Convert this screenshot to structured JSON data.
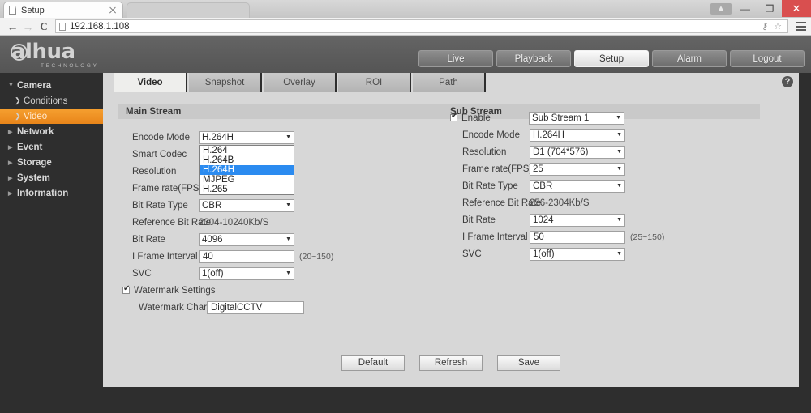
{
  "browser": {
    "tab_title": "Setup",
    "url": "192.168.1.108",
    "back_icon": "back-arrow-icon",
    "forward_icon": "forward-arrow-icon",
    "reload_icon": "reload-icon",
    "key_icon": "key-icon",
    "star_icon": "star-icon",
    "menu_icon": "hamburger-menu-icon",
    "minimize_label": "—",
    "restore_label": "❐",
    "close_label": "✕"
  },
  "brand": {
    "name": "alhua",
    "tagline": "TECHNOLOGY"
  },
  "topnav": {
    "items": [
      {
        "label": "Live",
        "active": false
      },
      {
        "label": "Playback",
        "active": false
      },
      {
        "label": "Setup",
        "active": true
      },
      {
        "label": "Alarm",
        "active": false
      },
      {
        "label": "Logout",
        "active": false
      }
    ]
  },
  "sidebar": {
    "items": [
      {
        "label": "Camera",
        "level": 0,
        "expanded": true,
        "active": false
      },
      {
        "label": "Conditions",
        "level": 1,
        "expanded": false,
        "active": false
      },
      {
        "label": "Video",
        "level": 1,
        "expanded": false,
        "active": true
      },
      {
        "label": "Network",
        "level": 0,
        "expanded": false,
        "active": false
      },
      {
        "label": "Event",
        "level": 0,
        "expanded": false,
        "active": false
      },
      {
        "label": "Storage",
        "level": 0,
        "expanded": false,
        "active": false
      },
      {
        "label": "System",
        "level": 0,
        "expanded": false,
        "active": false
      },
      {
        "label": "Information",
        "level": 0,
        "expanded": false,
        "active": false
      }
    ]
  },
  "tabs": [
    {
      "label": "Video",
      "active": true
    },
    {
      "label": "Snapshot",
      "active": false
    },
    {
      "label": "Overlay",
      "active": false
    },
    {
      "label": "ROI",
      "active": false
    },
    {
      "label": "Path",
      "active": false
    }
  ],
  "help": {
    "label": "?"
  },
  "main_stream": {
    "title": "Main Stream",
    "encode_mode": {
      "label": "Encode Mode",
      "value": "H.264H",
      "open": true,
      "options": [
        "H.264",
        "H.264B",
        "H.264H",
        "MJPEG",
        "H.265"
      ],
      "selected_option": "H.264H"
    },
    "smart_codec": {
      "label": "Smart Codec"
    },
    "resolution": {
      "label": "Resolution"
    },
    "frame_rate": {
      "label": "Frame rate(FPS)"
    },
    "bit_rate_type": {
      "label": "Bit Rate Type",
      "value": "CBR"
    },
    "reference_bit_rate": {
      "label": "Reference Bit Rate",
      "value": "2304-10240Kb/S"
    },
    "bit_rate": {
      "label": "Bit Rate",
      "value": "4096"
    },
    "i_frame_interval": {
      "label": "I Frame Interval",
      "value": "40",
      "hint": "(20~150)"
    },
    "svc": {
      "label": "SVC",
      "value": "1(off)"
    },
    "watermark_settings": {
      "label": "Watermark Settings",
      "checked": true
    },
    "watermark_character": {
      "label": "Watermark Character",
      "value": "DigitalCCTV"
    }
  },
  "sub_stream": {
    "title": "Sub Stream",
    "enable": {
      "label": "Enable",
      "checked": true,
      "value": "Sub Stream 1"
    },
    "encode_mode": {
      "label": "Encode Mode",
      "value": "H.264H"
    },
    "resolution": {
      "label": "Resolution",
      "value": "D1 (704*576)"
    },
    "frame_rate": {
      "label": "Frame rate(FPS)",
      "value": "25"
    },
    "bit_rate_type": {
      "label": "Bit Rate Type",
      "value": "CBR"
    },
    "reference_bit_rate": {
      "label": "Reference Bit Rate",
      "value": "256-2304Kb/S"
    },
    "bit_rate": {
      "label": "Bit Rate",
      "value": "1024"
    },
    "i_frame_interval": {
      "label": "I Frame Interval",
      "value": "50",
      "hint": "(25~150)"
    },
    "svc": {
      "label": "SVC",
      "value": "1(off)"
    }
  },
  "buttons": {
    "default": "Default",
    "refresh": "Refresh",
    "save": "Save"
  },
  "colors": {
    "accent_orange": "#e8851a",
    "dropdown_selected": "#2b8bf0",
    "close_red": "#d94f4f",
    "dark_bg": "#2e2e2e"
  }
}
